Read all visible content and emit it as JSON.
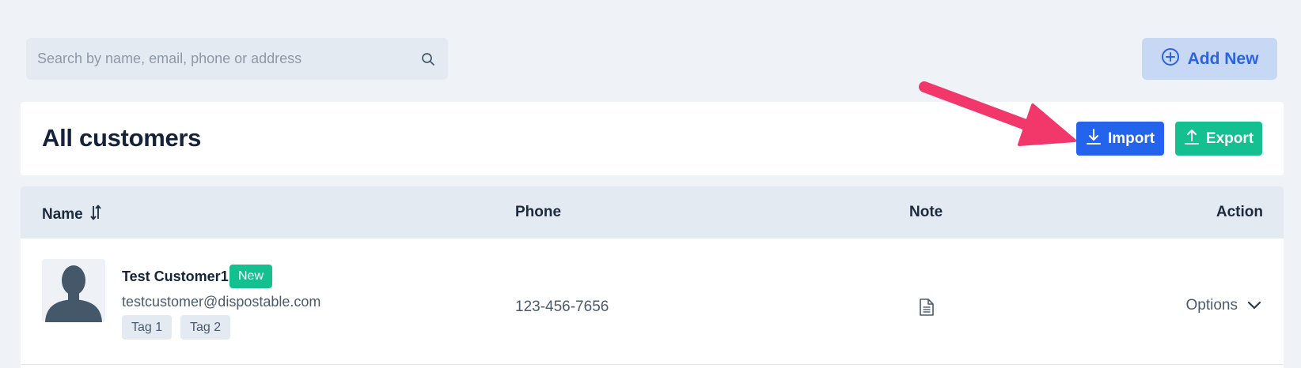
{
  "search": {
    "placeholder": "Search by name, email, phone or address",
    "icon": "search-icon"
  },
  "toolbar": {
    "add_new_label": "Add New",
    "add_new_icon": "plus-circle-icon"
  },
  "header": {
    "title": "All customers",
    "import_label": "Import",
    "export_label": "Export"
  },
  "table": {
    "columns": {
      "name": "Name",
      "phone": "Phone",
      "note": "Note",
      "action": "Action"
    },
    "rows": [
      {
        "name": "Test Customer1",
        "badge": "New",
        "email": "testcustomer@dispostable.com",
        "tags": [
          "Tag 1",
          "Tag 2"
        ],
        "phone": "123-456-7656",
        "action_label": "Options"
      }
    ]
  },
  "colors": {
    "import": "#2463eb",
    "export": "#14c08f",
    "annotation_arrow": "#f2386b",
    "add_new_bg": "#c7d8f5"
  }
}
